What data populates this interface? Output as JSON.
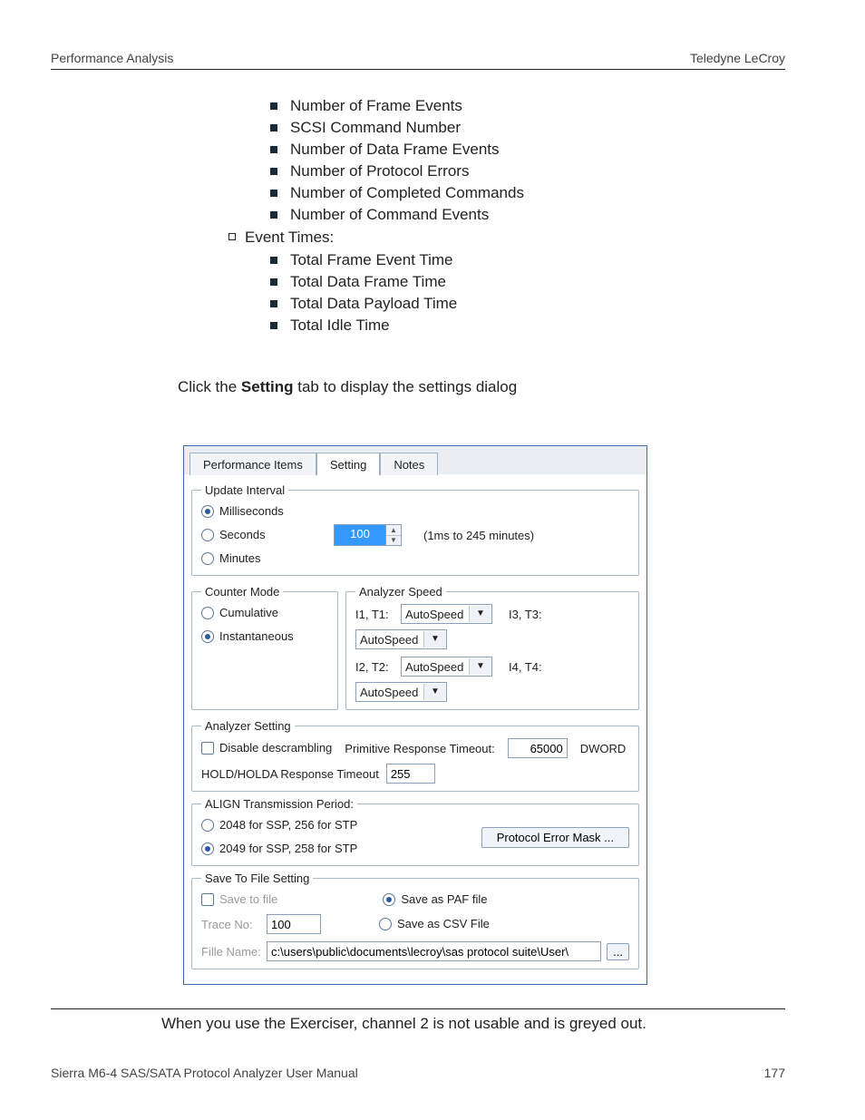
{
  "header": {
    "left": "Performance Analysis",
    "right": "Teledyne LeCroy"
  },
  "bullets": {
    "top": [
      "Number of Frame Events",
      "SCSI Command Number",
      "Number of Data Frame Events",
      "Number of Protocol Errors",
      "Number of Completed Commands",
      "Number of Command Events"
    ],
    "event_times_label": "Event Times:",
    "sub": [
      "Total Frame Event Time",
      "Total Data Frame Time",
      "Total Data Payload Time",
      "Total Idle Time"
    ]
  },
  "click_setting": {
    "pre": "Click the ",
    "bold": "Setting",
    "post": " tab to display the settings dialog"
  },
  "dialog": {
    "tabs": [
      "Performance Items",
      "Setting",
      "Notes"
    ],
    "active_tab": 1,
    "update_interval": {
      "legend": "Update Interval",
      "opts": [
        "Milliseconds",
        "Seconds",
        "Minutes"
      ],
      "selected": 0,
      "value": "100",
      "range": "(1ms to 245 minutes)"
    },
    "counter_mode": {
      "legend": "Counter Mode",
      "opts": [
        "Cumulative",
        "Instantaneous"
      ],
      "selected": 1
    },
    "analyzer_speed": {
      "legend": "Analyzer Speed",
      "labels": [
        "I1, T1:",
        "I2, T2:",
        "I3, T3:",
        "I4, T4:"
      ],
      "value": "AutoSpeed"
    },
    "analyzer_setting": {
      "legend": "Analyzer Setting",
      "disable": "Disable descrambling",
      "prim_label": "Primitive Response Timeout:",
      "prim_value": "65000",
      "prim_unit": "DWORD",
      "hold_label": "HOLD/HOLDA Response Timeout",
      "hold_value": "255"
    },
    "align": {
      "legend": "ALIGN Transmission Period:",
      "opts": [
        "2048 for SSP, 256 for STP",
        "2049 for SSP, 258 for STP"
      ],
      "selected": 1,
      "btn": "Protocol Error Mask ..."
    },
    "save": {
      "legend": "Save To File Setting",
      "save_to_file": "Save to file",
      "trace_label": "Trace No:",
      "trace_value": "100",
      "paf": "Save as PAF file",
      "csv": "Save as CSV File",
      "fname_label": "Fille Name:",
      "fname_value": "c:\\users\\public\\documents\\lecroy\\sas protocol suite\\User\\",
      "browse": "..."
    }
  },
  "note": "When you use the Exerciser, channel 2 is not usable and is greyed out.",
  "footer": {
    "left": "Sierra M6-4 SAS/SATA Protocol Analyzer User Manual",
    "right": "177"
  }
}
